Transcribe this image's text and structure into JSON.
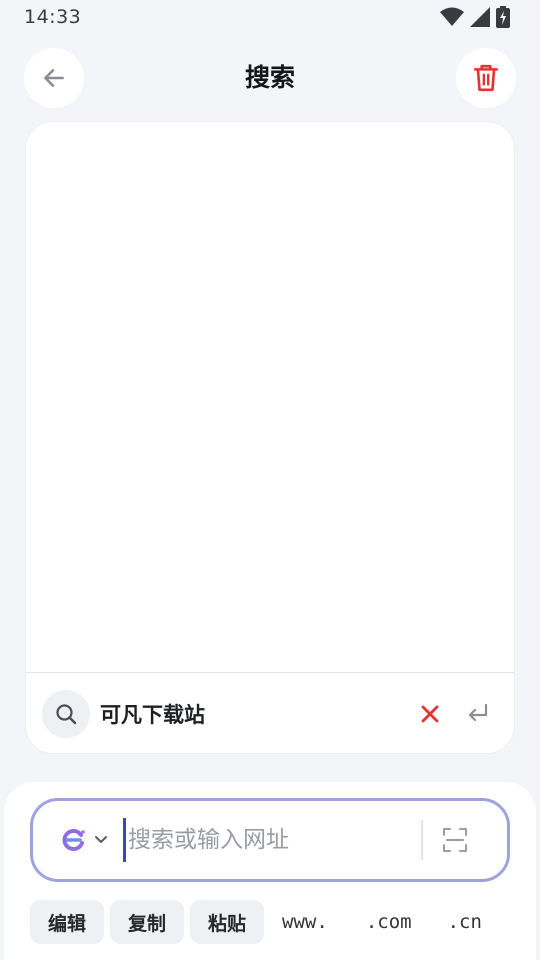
{
  "status_bar": {
    "time": "14:33",
    "icons": [
      "wifi-icon",
      "cell-signal-icon",
      "battery-charging-icon"
    ]
  },
  "header": {
    "title": "搜索",
    "back_icon": "arrow-left-icon",
    "trash_icon": "trash-icon"
  },
  "colors": {
    "accent": "#9ea3dd",
    "danger": "#e5322f",
    "background": "#f4f5f8"
  },
  "history": {
    "items": [
      {
        "text": "可凡下载站"
      }
    ]
  },
  "search": {
    "placeholder": "搜索或输入网址",
    "value": ""
  },
  "quick_actions": {
    "edit": "编辑",
    "copy": "复制",
    "paste": "粘贴",
    "www": "www.",
    "com": ".com",
    "cn": ".cn"
  }
}
